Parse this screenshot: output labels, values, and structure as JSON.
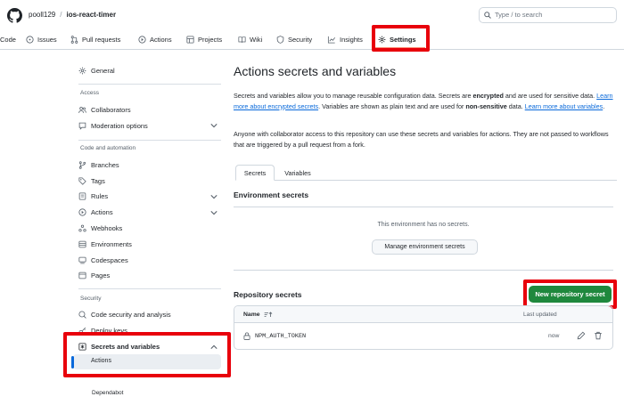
{
  "header": {
    "owner": "pooll129",
    "separator": "/",
    "repo": "ios-react-timer",
    "search_placeholder": "Type / to search"
  },
  "tabs": [
    {
      "label": "Code",
      "icon": "code-icon"
    },
    {
      "label": "Issues",
      "icon": "issue-icon"
    },
    {
      "label": "Pull requests",
      "icon": "pull-request-icon"
    },
    {
      "label": "Actions",
      "icon": "play-icon"
    },
    {
      "label": "Projects",
      "icon": "table-icon"
    },
    {
      "label": "Wiki",
      "icon": "book-icon"
    },
    {
      "label": "Security",
      "icon": "shield-icon"
    },
    {
      "label": "Insights",
      "icon": "graph-icon"
    },
    {
      "label": "Settings",
      "icon": "gear-icon",
      "selected": true
    }
  ],
  "sidebar": {
    "general": "General",
    "access_heading": "Access",
    "collaborators": "Collaborators",
    "moderation": "Moderation options",
    "code_heading": "Code and automation",
    "branches": "Branches",
    "tags": "Tags",
    "rules": "Rules",
    "actions": "Actions",
    "webhooks": "Webhooks",
    "environments": "Environments",
    "codespaces": "Codespaces",
    "pages": "Pages",
    "security_heading": "Security",
    "code_security": "Code security and analysis",
    "deploy_keys": "Deploy keys",
    "secrets": "Secrets and variables",
    "secrets_actions": "Actions",
    "dependabot": "Dependabot"
  },
  "main": {
    "title": "Actions secrets and variables",
    "intro_1": "Secrets and variables allow you to manage reusable configuration data. Secrets are ",
    "intro_bold_1": "encrypted",
    "intro_2": " and are used for sensitive data. ",
    "intro_link_1": "Learn more about encrypted secrets",
    "intro_3": ". Variables are shown as plain text and are used for ",
    "intro_bold_2": "non-sensitive",
    "intro_4": " data. ",
    "intro_link_2": "Learn more about variables",
    "intro_5": ".",
    "access_note": "Anyone with collaborator access to this repository can use these secrets and variables for actions. They are not passed to workflows that are triggered by a pull request from a fork.",
    "subtabs": [
      "Secrets",
      "Variables"
    ],
    "env_title": "Environment secrets",
    "env_empty": "This environment has no secrets.",
    "env_button": "Manage environment secrets",
    "repo_title": "Repository secrets",
    "new_button": "New repository secret",
    "table": {
      "col_name": "Name",
      "col_updated": "Last updated",
      "rows": [
        {
          "name": "NPM_AUTH_TOKEN",
          "updated": "now"
        }
      ]
    }
  },
  "colors": {
    "accent_link": "#0969da",
    "primary_button": "#1f883d",
    "highlight_box": "#e8000b",
    "selected_tab_underline": "#fd8c73"
  }
}
